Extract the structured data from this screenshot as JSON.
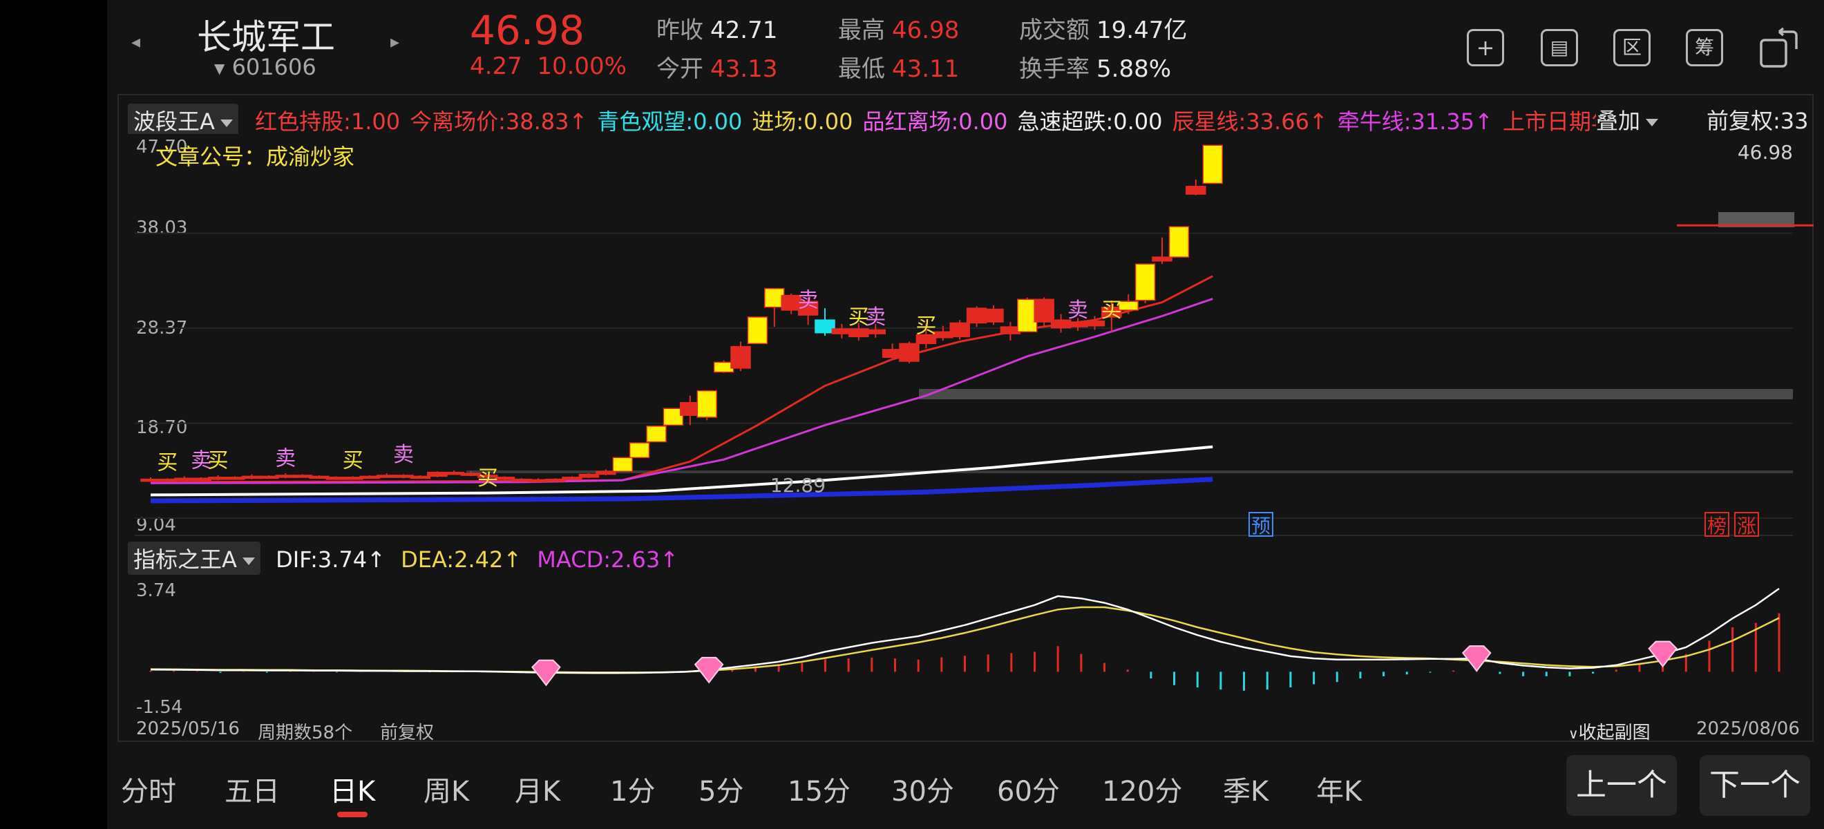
{
  "header": {
    "stock_name": "长城军工",
    "stock_code": "601606",
    "price": "46.98",
    "change": "4.27",
    "change_pct": "10.00%",
    "quotes": [
      {
        "label": "昨收",
        "value": "42.71",
        "color": "#e8e8e8"
      },
      {
        "label": "今开",
        "value": "43.13",
        "color": "#e8322e"
      },
      {
        "label": "最高",
        "value": "46.98",
        "color": "#e8322e"
      },
      {
        "label": "最低",
        "value": "43.11",
        "color": "#e8322e"
      },
      {
        "label": "成交额",
        "value": "19.47亿",
        "color": "#e8e8e8"
      },
      {
        "label": "换手率",
        "value": "5.88%",
        "color": "#e8e8e8"
      }
    ],
    "toolbar_icons": [
      "plus-square-icon",
      "chart-window-icon",
      "zone-icon",
      "calc-icon",
      "landscape-toggle-icon"
    ],
    "toolbar_glyphs": [
      "+",
      "▤",
      "区",
      "筹",
      ""
    ]
  },
  "main_chart": {
    "indicator_name": "波段王A",
    "legend": [
      {
        "text": "红色持股:1.00",
        "color": "#ef3b3b"
      },
      {
        "text": "今离场价:38.83↑",
        "color": "#ef3b3b"
      },
      {
        "text": "青色观望:0.00",
        "color": "#2ee0e8"
      },
      {
        "text": "进场:0.00",
        "color": "#f0d84a"
      },
      {
        "text": "品红离场:0.00",
        "color": "#ef5ef0"
      },
      {
        "text": "急速超跌:0.00",
        "color": "#f0f0f0"
      },
      {
        "text": "辰星线:33.66↑",
        "color": "#ef3b3b"
      },
      {
        "text": "牵牛线:31.35↑",
        "color": "#e040e8"
      },
      {
        "text": "上市日期年:",
        "color": "#ef3b3b"
      }
    ],
    "overlay_label": "叠加",
    "fuquan_label": "前复权:33",
    "article": "文章公号：成渝炒家",
    "y_labels": [
      "47.70",
      "38.03",
      "28.37",
      "18.70",
      "9.04"
    ],
    "current_price_label": "46.98",
    "low_label": "12.89",
    "badge_yu": "预",
    "badge_bang": "榜",
    "badge_zhang": "涨",
    "buy_text": "买",
    "sell_text": "卖"
  },
  "chart_data": [
    {
      "type": "candlestick",
      "title": "波段王A",
      "period_start": "2025/05/16",
      "period_end": "2025/08/06",
      "ylim": [
        9.04,
        47.7
      ],
      "candles": [
        {
          "o": 12.9,
          "c": 13.0,
          "h": 13.2,
          "l": 12.8
        },
        {
          "o": 13.0,
          "c": 12.9,
          "h": 13.1,
          "l": 12.8
        },
        {
          "o": 12.9,
          "c": 13.1,
          "h": 13.3,
          "l": 12.8
        },
        {
          "o": 13.1,
          "c": 13.0,
          "h": 13.2,
          "l": 12.9
        },
        {
          "o": 13.0,
          "c": 13.2,
          "h": 13.4,
          "l": 12.9
        },
        {
          "o": 13.2,
          "c": 13.1,
          "h": 13.3,
          "l": 13.0
        },
        {
          "o": 13.1,
          "c": 13.3,
          "h": 13.5,
          "l": 13.0
        },
        {
          "o": 13.3,
          "c": 13.2,
          "h": 13.4,
          "l": 13.1
        },
        {
          "o": 13.2,
          "c": 13.4,
          "h": 13.6,
          "l": 13.1
        },
        {
          "o": 13.4,
          "c": 13.3,
          "h": 13.5,
          "l": 13.2
        },
        {
          "o": 13.3,
          "c": 13.2,
          "h": 13.4,
          "l": 13.1
        },
        {
          "o": 13.2,
          "c": 13.1,
          "h": 13.3,
          "l": 13.0
        },
        {
          "o": 13.1,
          "c": 13.2,
          "h": 13.3,
          "l": 13.0
        },
        {
          "o": 13.2,
          "c": 13.3,
          "h": 13.4,
          "l": 13.1
        },
        {
          "o": 13.3,
          "c": 13.4,
          "h": 13.6,
          "l": 13.2
        },
        {
          "o": 13.4,
          "c": 13.2,
          "h": 13.5,
          "l": 13.1
        },
        {
          "o": 13.2,
          "c": 13.3,
          "h": 13.4,
          "l": 13.1
        },
        {
          "o": 13.3,
          "c": 13.7,
          "h": 13.8,
          "l": 13.2
        },
        {
          "o": 13.7,
          "c": 13.6,
          "h": 13.9,
          "l": 13.5
        },
        {
          "o": 13.6,
          "c": 13.4,
          "h": 13.8,
          "l": 13.3
        },
        {
          "o": 13.4,
          "c": 13.2,
          "h": 13.5,
          "l": 13.1
        },
        {
          "o": 13.2,
          "c": 13.0,
          "h": 13.3,
          "l": 12.9
        },
        {
          "o": 13.0,
          "c": 12.9,
          "h": 13.1,
          "l": 12.8
        },
        {
          "o": 12.9,
          "c": 12.95,
          "h": 13.1,
          "l": 12.89
        },
        {
          "o": 12.95,
          "c": 13.0,
          "h": 13.1,
          "l": 12.9
        },
        {
          "o": 13.0,
          "c": 13.2,
          "h": 13.3,
          "l": 12.9
        },
        {
          "o": 13.2,
          "c": 13.5,
          "h": 13.6,
          "l": 13.1
        },
        {
          "o": 13.5,
          "c": 13.8,
          "h": 14.0,
          "l": 13.4
        },
        {
          "o": 13.8,
          "c": 15.2,
          "h": 15.2,
          "l": 13.8
        },
        {
          "o": 15.2,
          "c": 16.7,
          "h": 16.7,
          "l": 15.2
        },
        {
          "o": 16.8,
          "c": 18.4,
          "h": 18.4,
          "l": 16.8
        },
        {
          "o": 18.5,
          "c": 20.2,
          "h": 20.2,
          "l": 18.5
        },
        {
          "o": 20.8,
          "c": 19.5,
          "h": 21.5,
          "l": 18.5
        },
        {
          "o": 19.3,
          "c": 22.0,
          "h": 22.0,
          "l": 19.0
        },
        {
          "o": 23.9,
          "c": 24.9,
          "h": 25.1,
          "l": 23.8
        },
        {
          "o": 26.5,
          "c": 24.3,
          "h": 27.0,
          "l": 24.0
        },
        {
          "o": 26.8,
          "c": 29.5,
          "h": 29.5,
          "l": 26.8
        },
        {
          "o": 30.5,
          "c": 32.4,
          "h": 32.4,
          "l": 28.5
        },
        {
          "o": 31.7,
          "c": 30.2,
          "h": 31.9,
          "l": 29.8
        },
        {
          "o": 31.1,
          "c": 29.7,
          "h": 31.5,
          "l": 28.7
        },
        {
          "o": 29.2,
          "c": 27.9,
          "h": 30.4,
          "l": 27.6
        },
        {
          "o": 28.3,
          "c": 27.8,
          "h": 28.8,
          "l": 27.3
        },
        {
          "o": 28.3,
          "c": 27.5,
          "h": 28.9,
          "l": 27.1
        },
        {
          "o": 28.2,
          "c": 27.8,
          "h": 28.8,
          "l": 27.4
        },
        {
          "o": 26.2,
          "c": 25.4,
          "h": 26.8,
          "l": 25.2
        },
        {
          "o": 26.8,
          "c": 25.0,
          "h": 27.0,
          "l": 24.8
        },
        {
          "o": 26.8,
          "c": 27.7,
          "h": 28.8,
          "l": 26.3
        },
        {
          "o": 28.0,
          "c": 27.4,
          "h": 28.6,
          "l": 27.1
        },
        {
          "o": 28.9,
          "c": 27.5,
          "h": 29.2,
          "l": 27.2
        },
        {
          "o": 30.4,
          "c": 28.9,
          "h": 30.6,
          "l": 28.5
        },
        {
          "o": 30.3,
          "c": 29.0,
          "h": 30.7,
          "l": 28.7
        },
        {
          "o": 28.5,
          "c": 27.8,
          "h": 29.0,
          "l": 27.1
        },
        {
          "o": 28.0,
          "c": 31.3,
          "h": 31.5,
          "l": 28.0
        },
        {
          "o": 31.3,
          "c": 29.0,
          "h": 31.5,
          "l": 28.5
        },
        {
          "o": 28.4,
          "c": 29.2,
          "h": 29.8,
          "l": 27.9
        },
        {
          "o": 29.0,
          "c": 28.5,
          "h": 29.4,
          "l": 28.1
        },
        {
          "o": 28.6,
          "c": 29.1,
          "h": 29.6,
          "l": 28.2
        },
        {
          "o": 30.5,
          "c": 29.5,
          "h": 31.2,
          "l": 28.0
        },
        {
          "o": 30.2,
          "c": 31.1,
          "h": 31.8,
          "l": 29.8
        },
        {
          "o": 31.2,
          "c": 34.9,
          "h": 34.9,
          "l": 30.9
        },
        {
          "o": 35.2,
          "c": 35.6,
          "h": 37.6,
          "l": 34.9
        },
        {
          "o": 35.6,
          "c": 38.7,
          "h": 38.7,
          "l": 35.6
        },
        {
          "o": 42.0,
          "c": 42.8,
          "h": 43.5,
          "l": 41.9
        },
        {
          "o": 43.1,
          "c": 46.98,
          "h": 46.98,
          "l": 43.1
        }
      ],
      "ma_lines": [
        {
          "name": "辰星线",
          "color": "#e22a22",
          "points": [
            [
              0,
              12.7
            ],
            [
              20,
              12.8
            ],
            [
              28,
              12.9
            ],
            [
              32,
              14.8
            ],
            [
              36,
              18.5
            ],
            [
              40,
              22.5
            ],
            [
              44,
              25.2
            ],
            [
              48,
              27.0
            ],
            [
              52,
              28.3
            ],
            [
              56,
              29.2
            ],
            [
              60,
              31.0
            ],
            [
              63,
              33.66
            ]
          ]
        },
        {
          "name": "牵牛线",
          "color": "#d235d8",
          "points": [
            [
              0,
              12.6
            ],
            [
              22,
              12.7
            ],
            [
              28,
              12.9
            ],
            [
              34,
              15.0
            ],
            [
              40,
              18.5
            ],
            [
              46,
              21.5
            ],
            [
              52,
              25.5
            ],
            [
              56,
              27.5
            ],
            [
              60,
              29.6
            ],
            [
              63,
              31.35
            ]
          ]
        },
        {
          "color": "#ffffff",
          "points": [
            [
              0,
              11.4
            ],
            [
              10,
              11.5
            ],
            [
              20,
              11.6
            ],
            [
              30,
              11.8
            ],
            [
              40,
              12.9
            ],
            [
              50,
              14.2
            ],
            [
              58,
              15.5
            ],
            [
              63,
              16.3
            ]
          ]
        },
        {
          "color": "#1f2bd9",
          "points": [
            [
              0,
              10.8
            ],
            [
              15,
              10.9
            ],
            [
              28,
              11.0
            ],
            [
              36,
              11.3
            ],
            [
              46,
              11.7
            ],
            [
              56,
              12.4
            ],
            [
              63,
              13.0
            ]
          ]
        }
      ],
      "signals": [
        {
          "i": 1,
          "text": "买",
          "value": 14.0
        },
        {
          "i": 3,
          "text": "卖",
          "value": 14.2
        },
        {
          "i": 4,
          "text": "买",
          "value": 14.2
        },
        {
          "i": 8,
          "text": "卖",
          "value": 14.4
        },
        {
          "i": 12,
          "text": "买",
          "value": 14.2
        },
        {
          "i": 15,
          "text": "卖",
          "value": 14.8
        },
        {
          "i": 20,
          "text": "买",
          "value": 12.4
        },
        {
          "i": 39,
          "text": "卖",
          "value": 30.5
        },
        {
          "i": 42,
          "text": "买",
          "value": 28.8
        },
        {
          "i": 43,
          "text": "卖",
          "value": 28.8
        },
        {
          "i": 46,
          "text": "买",
          "value": 27.9
        },
        {
          "i": 55,
          "text": "卖",
          "value": 29.5
        },
        {
          "i": 57,
          "text": "买",
          "value": 29.5
        }
      ]
    },
    {
      "type": "macd",
      "title": "指标之王A",
      "legend": [
        {
          "text": "DIF:3.74↑",
          "color": "#f0f0f0"
        },
        {
          "text": "DEA:2.42↑",
          "color": "#f0d84a"
        },
        {
          "text": "MACD:2.63↑",
          "color": "#e040e8"
        }
      ],
      "ylim": [
        -1.54,
        3.74
      ],
      "dif": [
        0.1,
        0.09,
        0.08,
        0.07,
        0.07,
        0.06,
        0.06,
        0.05,
        0.05,
        0.04,
        0.04,
        0.03,
        0.03,
        0.02,
        0.02,
        0.0,
        -0.02,
        -0.04,
        -0.05,
        -0.06,
        -0.06,
        -0.05,
        -0.03,
        0.0,
        0.08,
        0.2,
        0.32,
        0.45,
        0.65,
        0.9,
        1.1,
        1.3,
        1.45,
        1.6,
        1.85,
        2.1,
        2.4,
        2.7,
        3.0,
        3.4,
        3.3,
        3.1,
        2.8,
        2.4,
        2.0,
        1.65,
        1.35,
        1.1,
        0.9,
        0.7,
        0.6,
        0.55,
        0.55,
        0.55,
        0.56,
        0.58,
        0.58,
        0.6,
        0.4,
        0.28,
        0.2,
        0.15,
        0.18,
        0.3,
        0.55,
        0.8,
        1.1,
        1.7,
        2.4,
        3.0,
        3.74
      ],
      "dea": [
        0.12,
        0.11,
        0.1,
        0.09,
        0.09,
        0.08,
        0.08,
        0.07,
        0.07,
        0.06,
        0.05,
        0.05,
        0.04,
        0.03,
        0.02,
        0.01,
        0.0,
        -0.01,
        -0.02,
        -0.03,
        -0.03,
        -0.03,
        -0.02,
        0.0,
        0.05,
        0.12,
        0.2,
        0.3,
        0.45,
        0.62,
        0.8,
        0.98,
        1.15,
        1.32,
        1.52,
        1.75,
        2.0,
        2.28,
        2.55,
        2.8,
        2.9,
        2.9,
        2.75,
        2.55,
        2.3,
        2.0,
        1.75,
        1.5,
        1.25,
        1.05,
        0.88,
        0.78,
        0.7,
        0.65,
        0.62,
        0.6,
        0.55,
        0.5,
        0.45,
        0.38,
        0.3,
        0.25,
        0.22,
        0.25,
        0.35,
        0.5,
        0.7,
        1.0,
        1.4,
        1.9,
        2.42
      ],
      "macd": [
        0.05,
        0.04,
        0.03,
        -0.05,
        0.02,
        -0.04,
        0.03,
        0.02,
        -0.03,
        0.02,
        0.02,
        0.03,
        -0.02,
        0.02,
        0.01,
        -0.03,
        -0.04,
        -0.05,
        -0.04,
        -0.05,
        -0.04,
        -0.03,
        -0.02,
        0.01,
        0.06,
        0.16,
        0.24,
        0.3,
        0.4,
        0.56,
        0.6,
        0.64,
        0.6,
        0.55,
        0.65,
        0.72,
        0.78,
        0.84,
        0.9,
        1.15,
        0.8,
        0.4,
        0.1,
        -0.3,
        -0.6,
        -0.7,
        -0.8,
        -0.85,
        -0.8,
        -0.7,
        -0.56,
        -0.46,
        -0.3,
        -0.2,
        -0.12,
        -0.04,
        0.06,
        0.2,
        -0.1,
        -0.2,
        -0.2,
        -0.2,
        -0.08,
        0.1,
        0.4,
        0.6,
        0.8,
        1.4,
        2.0,
        2.2,
        2.63
      ],
      "diamonds": [
        17,
        24,
        57,
        65
      ]
    }
  ],
  "footer": {
    "date_start": "2025/05/16",
    "period_count": "周期数58个",
    "fuquan": "前复权",
    "collapse": "收起副图",
    "date_end": "2025/08/06"
  },
  "tabs": [
    "分时",
    "五日",
    "日K",
    "周K",
    "月K",
    "1分",
    "5分",
    "15分",
    "30分",
    "60分",
    "120分",
    "季K",
    "年K"
  ],
  "active_tab": "日K",
  "pager": {
    "prev": "上一个",
    "next": "下一个"
  }
}
